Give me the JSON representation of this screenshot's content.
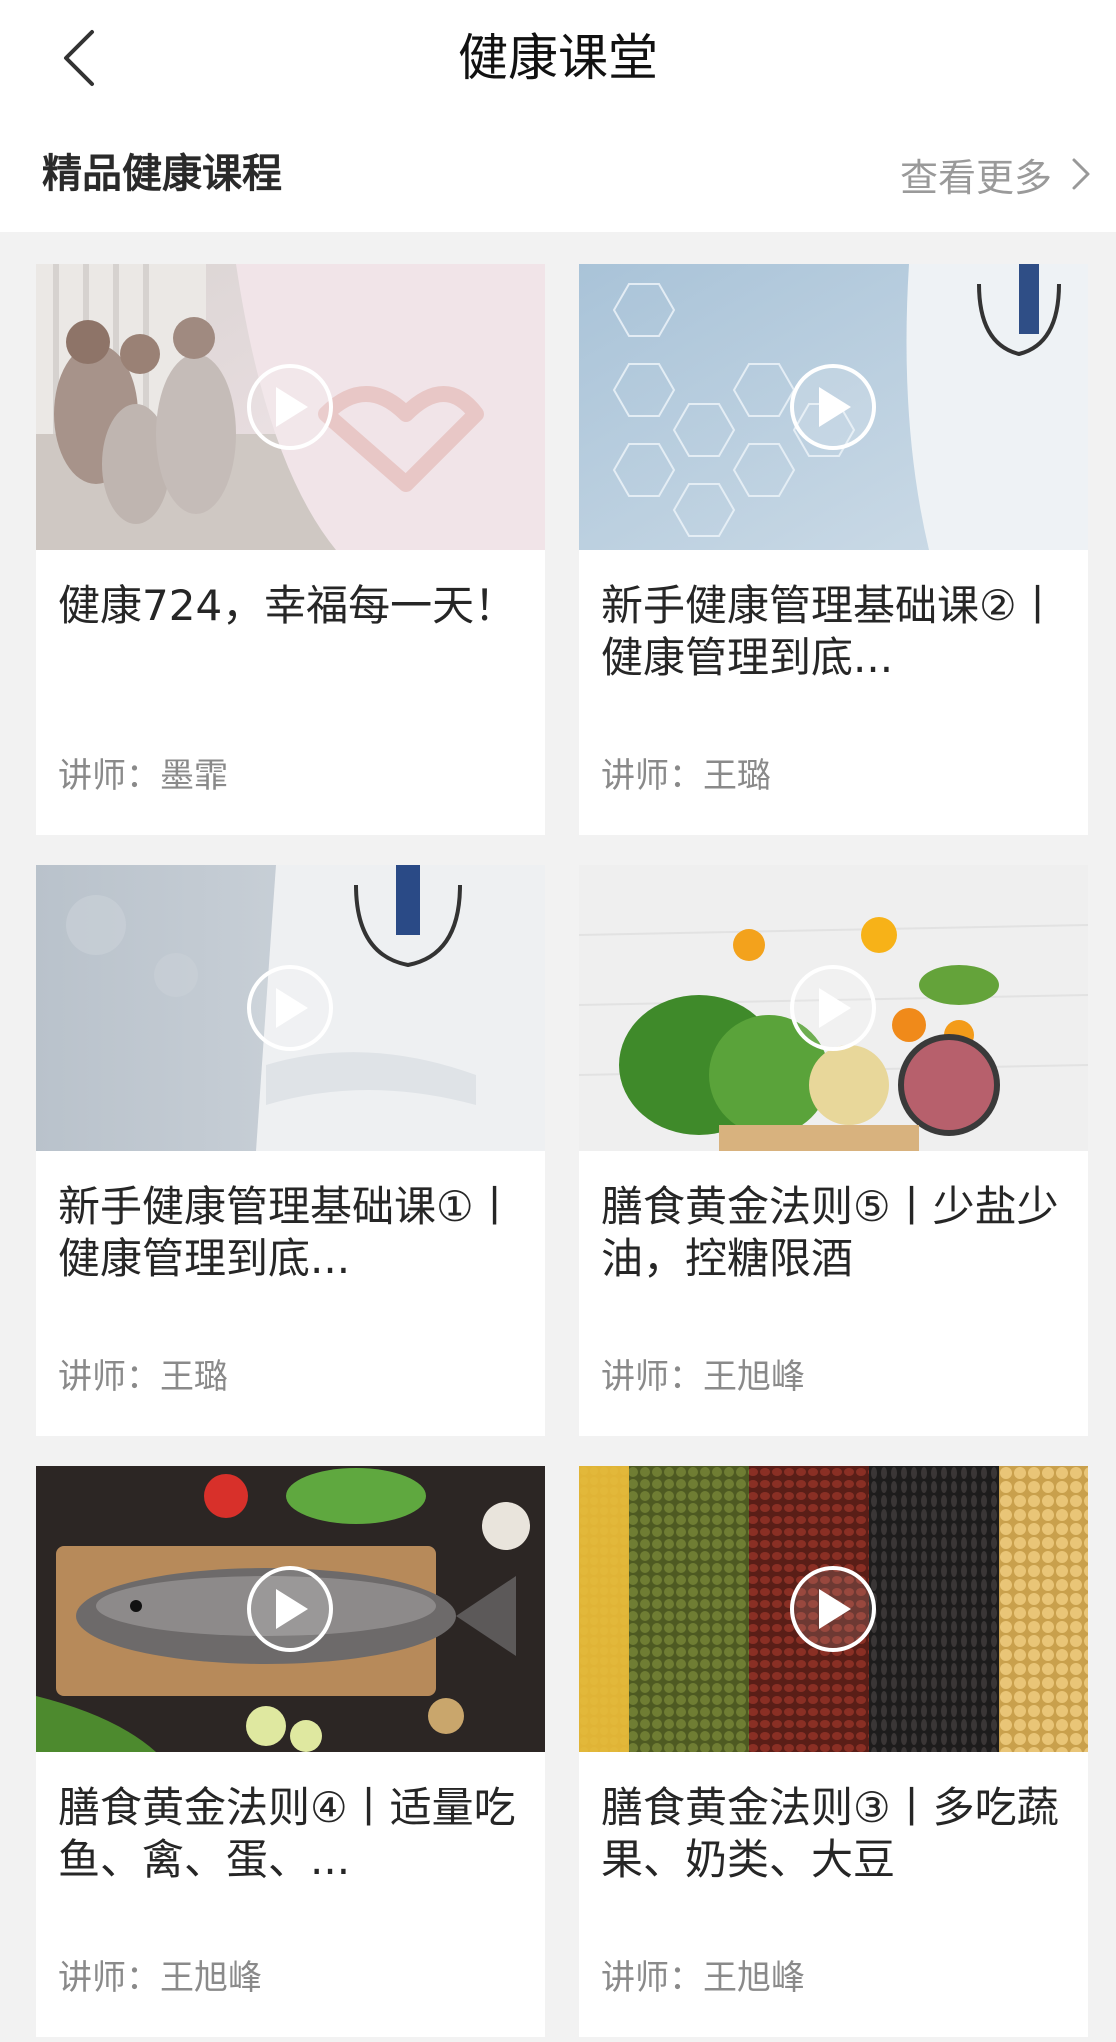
{
  "navbar": {
    "title": "健康课堂",
    "back_icon": "chevron-left-icon"
  },
  "section": {
    "title": "精品健康课程",
    "more_label": "查看更多",
    "more_icon": "chevron-right-icon"
  },
  "colors": {
    "background": "#f2f2f2",
    "card": "#ffffff",
    "muted_text": "#8a8a8a"
  },
  "courses": [
    {
      "title": "健康724，幸福每一天！",
      "instructor_label": "讲师：",
      "instructor": "墨霏",
      "thumbnail": "family-and-doctor-hands-heart"
    },
    {
      "title": "新手健康管理基础课②丨健康管理到底...",
      "instructor_label": "讲师：",
      "instructor": "王璐",
      "thumbnail": "doctor-medical-hexagon-icons"
    },
    {
      "title": "新手健康管理基础课①丨健康管理到底...",
      "instructor_label": "讲师：",
      "instructor": "王璐",
      "thumbnail": "doctor-arms-crossed"
    },
    {
      "title": "膳食黄金法则⑤丨少盐少油，控糖限酒",
      "instructor_label": "讲师：",
      "instructor": "王旭峰",
      "thumbnail": "vegetables-and-fruits"
    },
    {
      "title": "膳食黄金法则④丨适量吃鱼、禽、蛋、...",
      "instructor_label": "讲师：",
      "instructor": "王旭峰",
      "thumbnail": "fish-on-cutting-board"
    },
    {
      "title": "膳食黄金法则③丨多吃蔬果、奶类、大豆",
      "instructor_label": "讲师：",
      "instructor": "王旭峰",
      "thumbnail": "grains-and-beans"
    }
  ]
}
